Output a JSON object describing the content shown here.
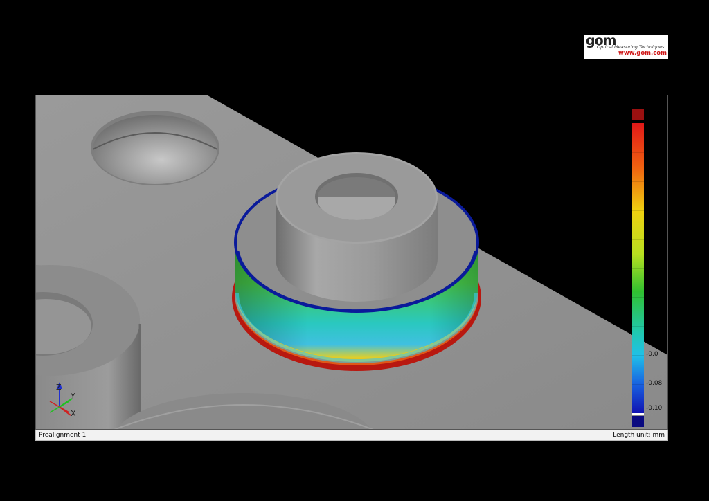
{
  "logo": {
    "word": "gom",
    "subtitle": "Optical Measuring Techniques",
    "url": "www.gom.com"
  },
  "viewport": {
    "axis_labels": {
      "z": "Z",
      "y": "Y",
      "x": "X"
    },
    "scale_labels": [
      "-0.0",
      "-0.08",
      "-0.10"
    ]
  },
  "status": {
    "left": "Prealignment 1",
    "right": "Length unit: mm"
  },
  "colors": {
    "background": "#000000",
    "surface_gray": "#8c8c8c",
    "deviation_red": "#c81810",
    "deviation_blue": "#0a1a9a",
    "deviation_green": "#3cc83a",
    "deviation_cyan": "#28c8d8"
  }
}
